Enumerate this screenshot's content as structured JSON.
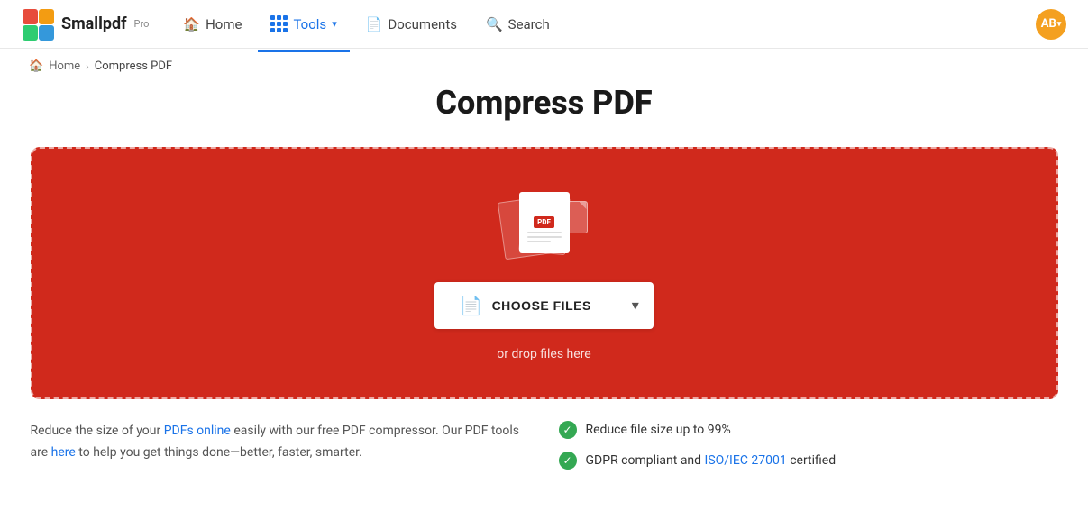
{
  "brand": {
    "logo_text": "Smallpdf",
    "logo_pro": "Pro",
    "avatar_initials": "AB"
  },
  "navbar": {
    "home_label": "Home",
    "tools_label": "Tools",
    "documents_label": "Documents",
    "search_label": "Search"
  },
  "breadcrumb": {
    "home_label": "Home",
    "current_label": "Compress PDF"
  },
  "page": {
    "title": "Compress PDF"
  },
  "dropzone": {
    "choose_files_label": "CHOOSE FILES",
    "drop_text": "or drop files here"
  },
  "bottom": {
    "description": "Reduce the size of your PDFs online easily with our free PDF compressor. Our PDF tools are here to help you get things done—better, faster, smarter.",
    "link1_text": "PDFs online",
    "link2_text": "here",
    "feature1": "Reduce file size up to 99%",
    "feature2": "GDPR compliant and ISO/IEC 27001 certified",
    "feature2_link": "ISO/IEC 27001"
  }
}
